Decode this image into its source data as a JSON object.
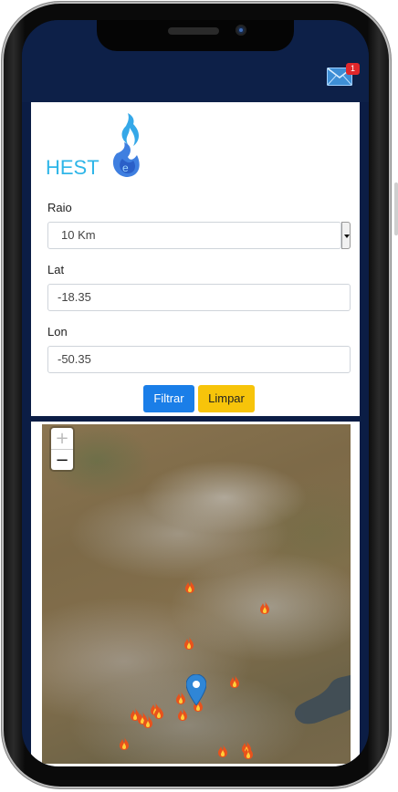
{
  "header": {
    "notification_count": "1",
    "mail_icon": "envelope-icon"
  },
  "logo": {
    "text": "HEST"
  },
  "form": {
    "raio": {
      "label": "Raio",
      "selected": "10 Km"
    },
    "lat": {
      "label": "Lat",
      "value": "-18.35"
    },
    "lon": {
      "label": "Lon",
      "value": "-50.35"
    },
    "filter_label": "Filtrar",
    "clear_label": "Limpar"
  },
  "map": {
    "zoom_in_label": "+",
    "zoom_out_label": "−",
    "fire_icon": "fire-icon",
    "marker_icon": "map-pin-icon"
  },
  "colors": {
    "header_bg": "#0d2048",
    "primary": "#1a7ee8",
    "warning": "#f7c40a",
    "badge": "#e0262a",
    "logo_blue": "#2fb6e8"
  }
}
